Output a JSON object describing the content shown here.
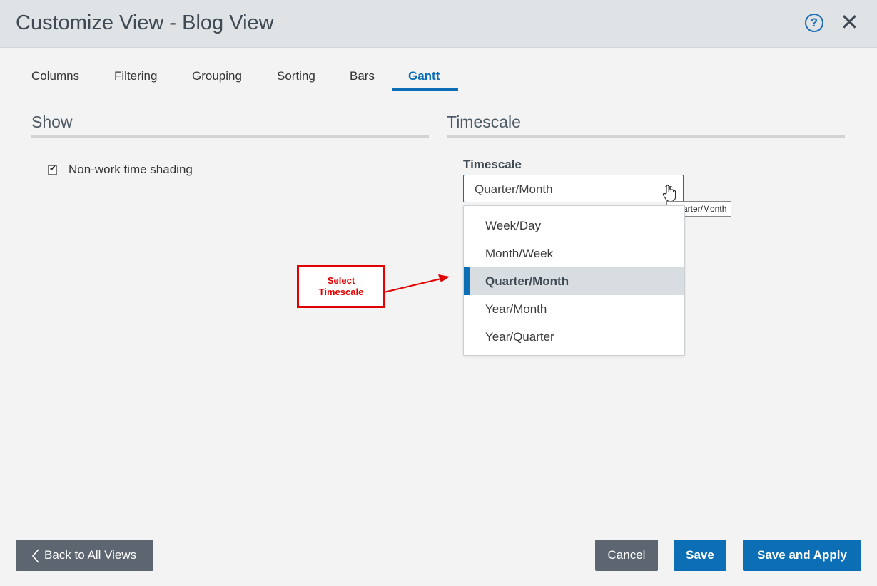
{
  "header": {
    "title": "Customize View - Blog View"
  },
  "tabs": [
    "Columns",
    "Filtering",
    "Grouping",
    "Sorting",
    "Bars",
    "Gantt"
  ],
  "show": {
    "title": "Show",
    "checkbox_label": "Non-work time shading",
    "checked": true
  },
  "timescale": {
    "section_title": "Timescale",
    "field_label": "Timescale",
    "value": "Quarter/Month",
    "tooltip": "Quarter/Month",
    "options": [
      "Week/Day",
      "Month/Week",
      "Quarter/Month",
      "Year/Month",
      "Year/Quarter"
    ],
    "selected": "Quarter/Month"
  },
  "annotation": {
    "line1": "Select",
    "line2": "Timescale"
  },
  "footer": {
    "back": "Back to All Views",
    "cancel": "Cancel",
    "save": "Save",
    "save_apply": "Save and Apply"
  },
  "colors": {
    "accent": "#0c6fb5",
    "annotation": "#e10000",
    "header_bg": "#dfe3e5"
  }
}
